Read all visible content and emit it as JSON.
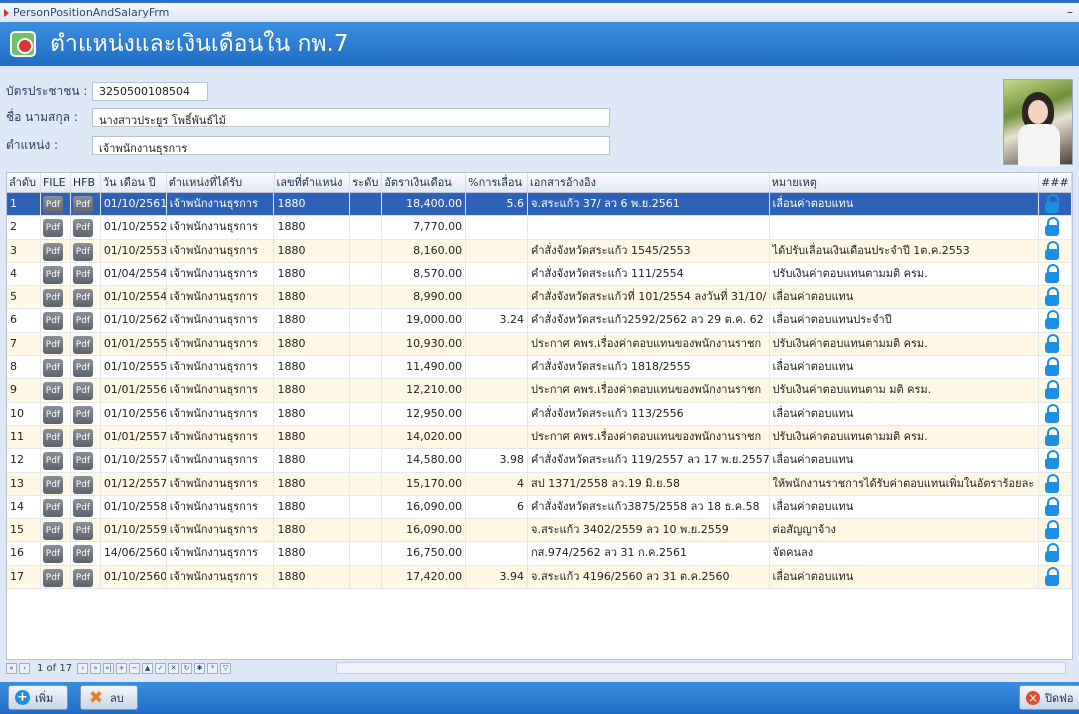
{
  "window": {
    "title": "PersonPositionAndSalaryFrm"
  },
  "header": {
    "title": "ตำแหน่งและเงินเดือนใน กพ.7"
  },
  "person": {
    "id_label": "บัตรประชาชน :",
    "id_value": "3250500108504",
    "name_label": "ชื่อ นามสกุล :",
    "name_value": "นางสาวประยูร โพธิ์พันธ์ไม้",
    "position_label": "ตำแหน่ง :",
    "position_value": "เจ้าพนักงานธุรการ"
  },
  "table": {
    "columns": [
      "ลำดับ",
      "FILE",
      "HFB",
      "วัน เดือน ปี",
      "ตำแหน่งที่ได้รับ",
      "เลขที่ตำแหน่ง",
      "ระดับ",
      "อัตราเงินเดือน",
      "%การเลื่อน",
      "เอกสารอ้างอิง",
      "หมายเหตุ",
      "###"
    ],
    "pdf_label": "Pdf",
    "rows": [
      {
        "no": "1",
        "date": "01/10/2561",
        "position": "เจ้าพนักงานธุรการ",
        "pos_no": "1880",
        "level": "",
        "salary": "18,400.00",
        "pct": "5.6",
        "ref": "จ.สระแก้ว 37/ ลว 6 พ.ย.2561",
        "note": "เลื่อนค่าตอบแทน"
      },
      {
        "no": "2",
        "date": "01/10/2552",
        "position": "เจ้าพนักงานธุรการ",
        "pos_no": "1880",
        "level": "",
        "salary": "7,770.00",
        "pct": "",
        "ref": "",
        "note": ""
      },
      {
        "no": "3",
        "date": "01/10/2553",
        "position": "เจ้าพนักงานธุรการ",
        "pos_no": "1880",
        "level": "",
        "salary": "8,160.00",
        "pct": "",
        "ref": "คำสั่งจังหวัดสระแก้ว 1545/2553",
        "note": "ได้ปรับเลื่อนเงินเดือนประจำปี 1ต.ค.2553"
      },
      {
        "no": "4",
        "date": "01/04/2554",
        "position": "เจ้าพนักงานธุรการ",
        "pos_no": "1880",
        "level": "",
        "salary": "8,570.00",
        "pct": "",
        "ref": "คำสั่งจังหวัดสระแก้ว 111/2554",
        "note": "ปรับเงินค่าตอบแทนตามมติ ครม."
      },
      {
        "no": "5",
        "date": "01/10/2554",
        "position": "เจ้าพนักงานธุรการ",
        "pos_no": "1880",
        "level": "",
        "salary": "8,990.00",
        "pct": "",
        "ref": "คำสั่งจังหวัดสระแก้วที่ 101/2554 ลงวันที่ 31/10/",
        "note": "เลื่อนค่าตอบแทน"
      },
      {
        "no": "6",
        "date": "01/10/2562",
        "position": "เจ้าพนักงานธุรการ",
        "pos_no": "1880",
        "level": "",
        "salary": "19,000.00",
        "pct": "3.24",
        "ref": "คำสั่งจังหวัดสระแก้ว2592/2562 ลว 29 ต.ค. 62",
        "note": "เลื่อนค่าตอบแทนประจำปี"
      },
      {
        "no": "7",
        "date": "01/01/2555",
        "position": "เจ้าพนักงานธุรการ",
        "pos_no": "1880",
        "level": "",
        "salary": "10,930.00",
        "pct": "",
        "ref": "ประกาศ คพร.เรื่องค่าตอบแทนของพนักงานราชก",
        "note": "ปรับเงินค่าตอบแทนตามมติ ครม."
      },
      {
        "no": "8",
        "date": "01/10/2555",
        "position": "เจ้าพนักงานธุรการ",
        "pos_no": "1880",
        "level": "",
        "salary": "11,490.00",
        "pct": "",
        "ref": "คำสั่งจังหวัดสระแก้ว 1818/2555",
        "note": "เลื่อนค่าตอบแทน"
      },
      {
        "no": "9",
        "date": "01/01/2556",
        "position": "เจ้าพนักงานธุรการ",
        "pos_no": "1880",
        "level": "",
        "salary": "12,210.00",
        "pct": "",
        "ref": "ประกาศ คพร.เรื่องค่าตอบแทนของพนักงานราชก",
        "note": "ปรับเงินค่าตอบแทนตาม มติ ครม."
      },
      {
        "no": "10",
        "date": "01/10/2556",
        "position": "เจ้าพนักงานธุรการ",
        "pos_no": "1880",
        "level": "",
        "salary": "12,950.00",
        "pct": "",
        "ref": "คำสั่งจังหวัดสระแก้ว 113/2556",
        "note": "เลื่อนค่าตอบแทน"
      },
      {
        "no": "11",
        "date": "01/01/2557",
        "position": "เจ้าพนักงานธุรการ",
        "pos_no": "1880",
        "level": "",
        "salary": "14,020.00",
        "pct": "",
        "ref": "ประกาศ คพร.เรื่องค่าตอบแทนของพนักงานราชก",
        "note": "ปรับเงินค่าตอบแทนตามมติ ครม."
      },
      {
        "no": "12",
        "date": "01/10/2557",
        "position": "เจ้าพนักงานธุรการ",
        "pos_no": "1880",
        "level": "",
        "salary": "14,580.00",
        "pct": "3.98",
        "ref": "คำสั่งจังหวัดสระแก้ว 119/2557 ลว 17 พ.ย.2557",
        "note": "เลื่อนค่าตอบแทน"
      },
      {
        "no": "13",
        "date": "01/12/2557",
        "position": "เจ้าพนักงานธุรการ",
        "pos_no": "1880",
        "level": "",
        "salary": "15,170.00",
        "pct": "4",
        "ref": "สป 1371/2558 ลว.19 มิ.ย.58",
        "note": "ให้พนักงานราชการได้รับค่าตอบแทนเพิ่มในอัตราร้อยละ"
      },
      {
        "no": "14",
        "date": "01/10/2558",
        "position": "เจ้าพนักงานธุรการ",
        "pos_no": "1880",
        "level": "",
        "salary": "16,090.00",
        "pct": "6",
        "ref": "คำสั่งจังหวัดสระแก้ว3875/2558 ลว 18 ธ.ค.58",
        "note": "เลื่อนค่าตอบแทน"
      },
      {
        "no": "15",
        "date": "01/10/2559",
        "position": "เจ้าพนักงานธุรการ",
        "pos_no": "1880",
        "level": "",
        "salary": "16,090.00",
        "pct": "",
        "ref": "จ.สระแก้ว 3402/2559 ลว 10 พ.ย.2559",
        "note": "ต่อสัญญาจ้าง"
      },
      {
        "no": "16",
        "date": "14/06/2560",
        "position": "เจ้าพนักงานธุรการ",
        "pos_no": "1880",
        "level": "",
        "salary": "16,750.00",
        "pct": "",
        "ref": "กส.974/2562 ลว 31 ก.ค.2561",
        "note": "จัดคนลง"
      },
      {
        "no": "17",
        "date": "01/10/2560",
        "position": "เจ้าพนักงานธุรการ",
        "pos_no": "1880",
        "level": "",
        "salary": "17,420.00",
        "pct": "3.94",
        "ref": "จ.สระแก้ว 4196/2560 ลว 31 ต.ค.2560",
        "note": "เลื่อนค่าตอบแทน"
      }
    ],
    "selected_row": 1
  },
  "navigator": {
    "page_text": "1 of 17"
  },
  "buttons": {
    "add": "เพิ่ม",
    "delete": "ลบ",
    "close": "ปิดฟอ"
  },
  "colors": {
    "header_blue": "#1f6dc4",
    "selected_row": "#2e62b8",
    "odd_row": "#fdf7e4",
    "lock_icon": "#1b8fe3"
  }
}
